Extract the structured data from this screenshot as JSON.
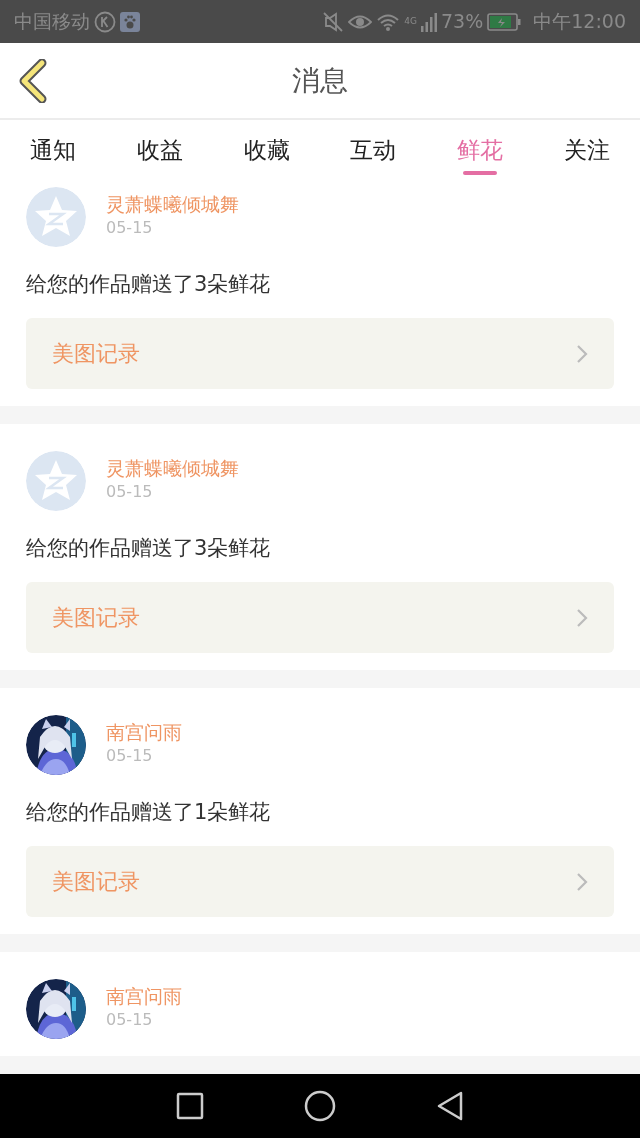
{
  "status_bar": {
    "carrier": "中国移动",
    "network": "4G",
    "battery": "73%",
    "time": "中午12:00"
  },
  "header": {
    "title": "消息"
  },
  "tabs": [
    {
      "label": "通知",
      "selected": false
    },
    {
      "label": "收益",
      "selected": false
    },
    {
      "label": "收藏",
      "selected": false
    },
    {
      "label": "互动",
      "selected": false
    },
    {
      "label": "鲜花",
      "selected": true
    },
    {
      "label": "关注",
      "selected": false
    }
  ],
  "messages": [
    {
      "avatar": {
        "kind": "default"
      },
      "name": "灵萧蝶曦倾城舞",
      "date": "05-15",
      "text": "给您的作品赠送了3朵鲜花",
      "link": "美图记录"
    },
    {
      "avatar": {
        "kind": "default"
      },
      "name": "灵萧蝶曦倾城舞",
      "date": "05-15",
      "text": "给您的作品赠送了3朵鲜花",
      "link": "美图记录"
    },
    {
      "name": "南宫问雨",
      "date": "05-15",
      "text": "给您的作品赠送了1朵鲜花",
      "link": "美图记录"
    },
    {
      "name": "南宫问雨",
      "date": "05-15"
    }
  ]
}
